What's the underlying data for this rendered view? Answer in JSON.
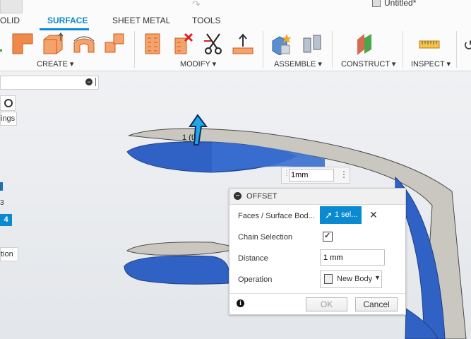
{
  "title": {
    "tab_text": "Untitled*"
  },
  "tabs": [
    {
      "label": "OLID"
    },
    {
      "label": "SURFACE"
    },
    {
      "label": "SHEET METAL"
    },
    {
      "label": "TOOLS"
    }
  ],
  "groups": {
    "create": "CREATE",
    "modify": "MODIFY",
    "assemble": "ASSEMBLE",
    "construct": "CONSTRUCT",
    "inspect": "INSPECT"
  },
  "left_panel": {
    "settings_fragment": "ings",
    "item_3": "3",
    "item_4": "4",
    "tion_fragment": "tion"
  },
  "viewport": {
    "distance_manipulator": "1mm",
    "arrow_label": "1 (t)"
  },
  "offset_dialog": {
    "title": "OFFSET",
    "faces_label": "Faces / Surface Bod...",
    "faces_value": "1 sel...",
    "chain_label": "Chain Selection",
    "chain_checked": true,
    "distance_label": "Distance",
    "distance_value": "1 mm",
    "operation_label": "Operation",
    "operation_value": "New Body",
    "ok_label": "OK",
    "cancel_label": "Cancel"
  },
  "colors": {
    "accent": "#0a8bd1",
    "surface_blue": "#2f62c4",
    "surface_gray": "#c9c7bf"
  }
}
